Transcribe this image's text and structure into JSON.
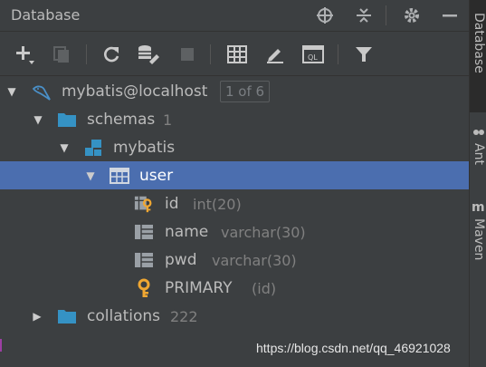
{
  "header": {
    "title": "Database"
  },
  "toolbar": {},
  "tree": {
    "root": {
      "label": "mybatis@localhost",
      "badge": "1 of 6"
    },
    "schemas": {
      "label": "schemas",
      "count": "1"
    },
    "schema": {
      "label": "mybatis"
    },
    "table": {
      "label": "user"
    },
    "columns": [
      {
        "name": "id",
        "type": "int(20)"
      },
      {
        "name": "name",
        "type": "varchar(30)"
      },
      {
        "name": "pwd",
        "type": "varchar(30)"
      }
    ],
    "key": {
      "name": "PRIMARY",
      "detail": "(id)"
    },
    "collations": {
      "label": "collations",
      "count": "222"
    }
  },
  "strip": {
    "tabs": [
      "Database",
      "Ant",
      "Maven"
    ]
  },
  "watermark": "https://blog.csdn.net/qq_46921028",
  "colors": {
    "selection": "#4b6eaf",
    "folder": "#3592c4",
    "key": "#f0a732",
    "background": "#3c3f41"
  }
}
